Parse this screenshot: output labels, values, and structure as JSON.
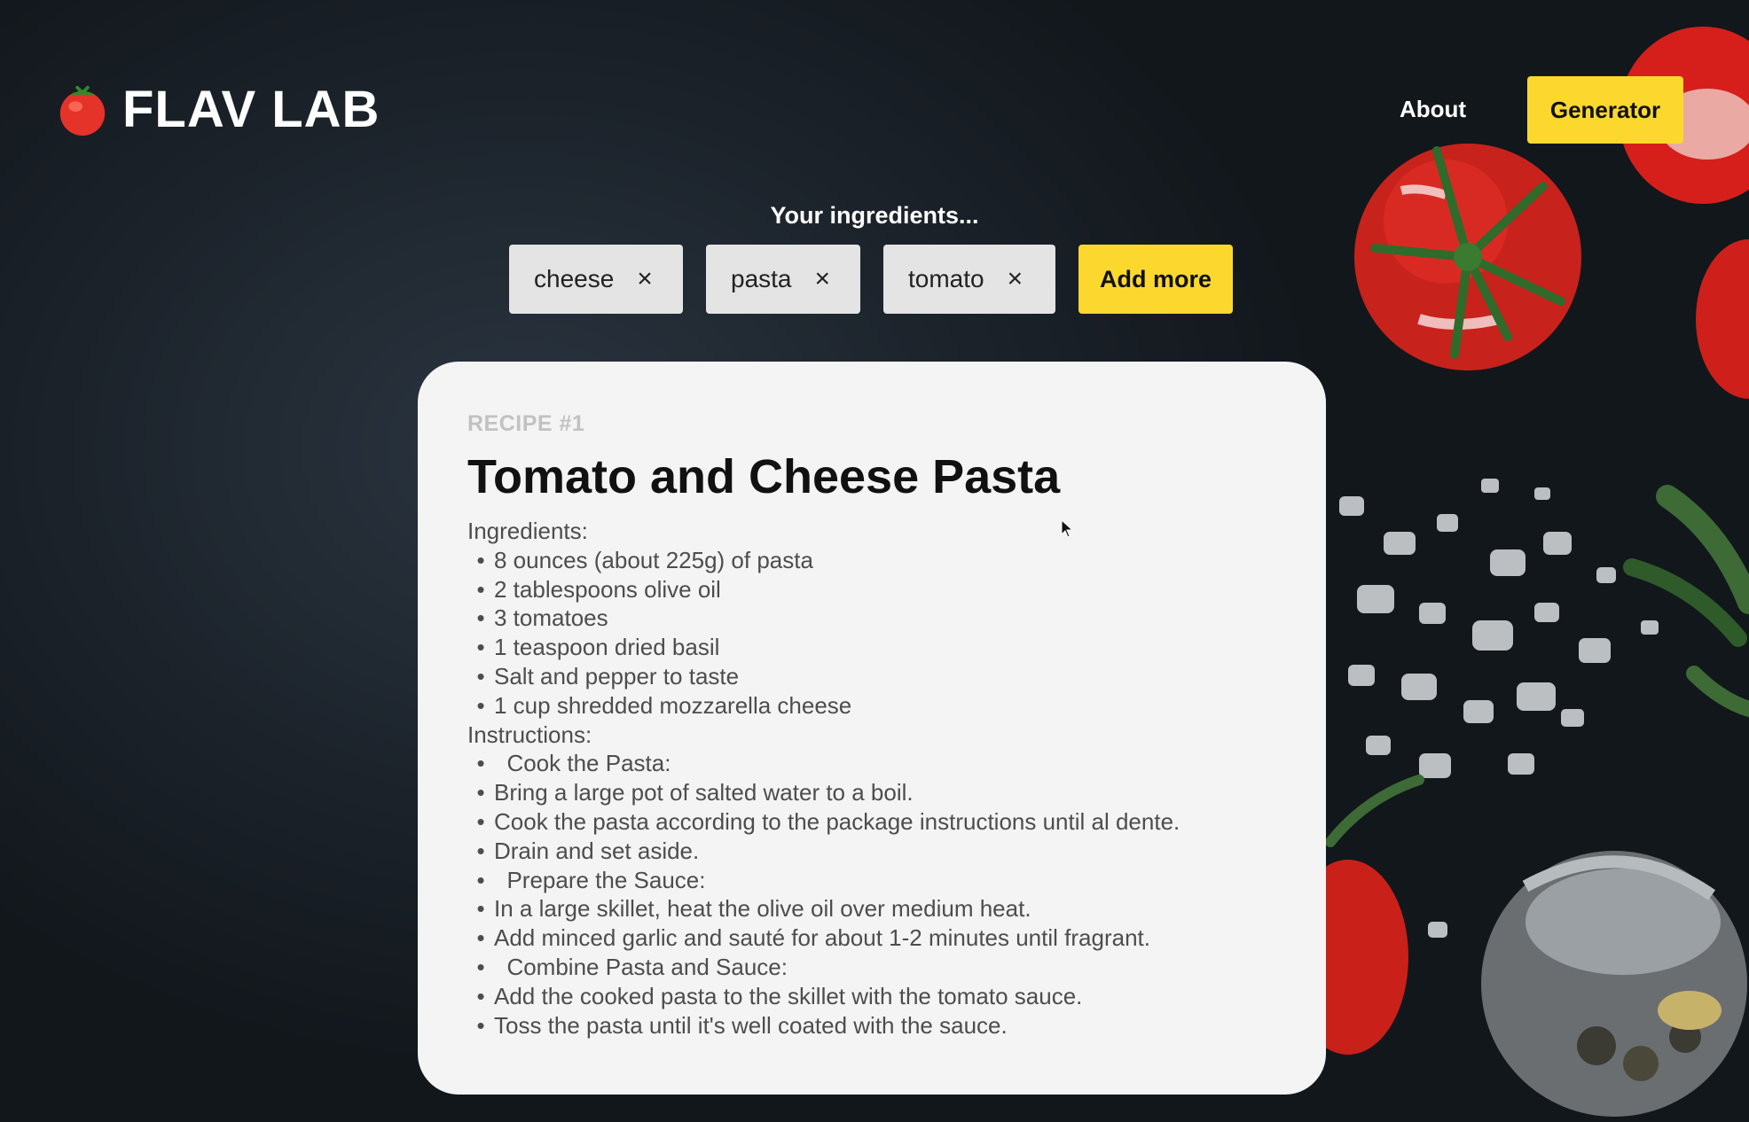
{
  "header": {
    "brand_name": "FLAV LAB",
    "logo_icon": "tomato-icon",
    "nav": {
      "about_label": "About",
      "generator_label": "Generator"
    }
  },
  "ingredients": {
    "heading": "Your ingredients...",
    "chips": [
      {
        "label": "cheese"
      },
      {
        "label": "pasta"
      },
      {
        "label": "tomato"
      }
    ],
    "remove_icon": "close-icon",
    "add_more_label": "Add more"
  },
  "recipe": {
    "label": "RECIPE #1",
    "title": "Tomato and Cheese Pasta",
    "ingredients_heading": "Ingredients:",
    "ingredients": [
      "8 ounces (about 225g) of pasta",
      "2 tablespoons olive oil",
      "3 tomatoes",
      "1 teaspoon dried basil",
      "Salt and pepper to taste",
      "1 cup shredded mozzarella cheese"
    ],
    "instructions_heading": "Instructions:",
    "instructions": [
      "  Cook the Pasta:",
      "Bring a large pot of salted water to a boil.",
      "Cook the pasta according to the package instructions until al dente.",
      "Drain and set aside.",
      "  Prepare the Sauce:",
      "In a large skillet, heat the olive oil over medium heat.",
      "Add minced garlic and sauté for about 1-2 minutes until fragrant.",
      "  Combine Pasta and Sauce:",
      "Add the cooked pasta to the skillet with the tomato sauce.",
      "Toss the pasta until it's well coated with the sauce."
    ]
  },
  "colors": {
    "accent": "#fcd82e",
    "background": "#1c232b",
    "card": "#f4f4f4",
    "chip": "#e4e4e4"
  }
}
